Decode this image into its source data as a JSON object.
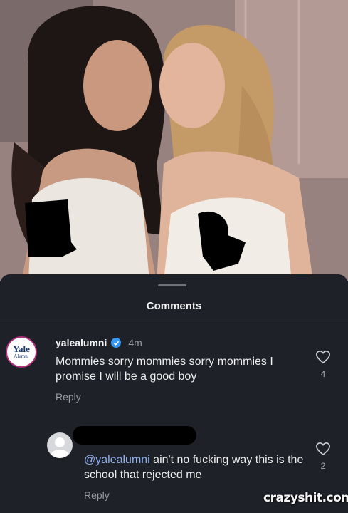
{
  "sheet": {
    "title": "Comments"
  },
  "comments": [
    {
      "avatar_line1": "Yale",
      "avatar_line2": "Alumni",
      "username": "yalealumni",
      "verified_icon": "verified-badge-icon",
      "time": "4m",
      "text": "Mommies sorry mommies sorry mommies I promise I will be a good boy",
      "reply_label": "Reply",
      "like_icon": "heart-outline-icon",
      "likes": "4"
    },
    {
      "username_redacted": true,
      "mention": "@yalealumni",
      "text": " ain't no fucking way this is the school that rejected me",
      "reply_label": "Reply",
      "like_icon": "heart-outline-icon",
      "likes": "2"
    }
  ],
  "watermark": "crazyshit.com",
  "colors": {
    "sheet_bg": "#1e2128",
    "verified": "#3797f0",
    "mention": "#8fb0ee",
    "yale_ring": "#b22f7a"
  }
}
